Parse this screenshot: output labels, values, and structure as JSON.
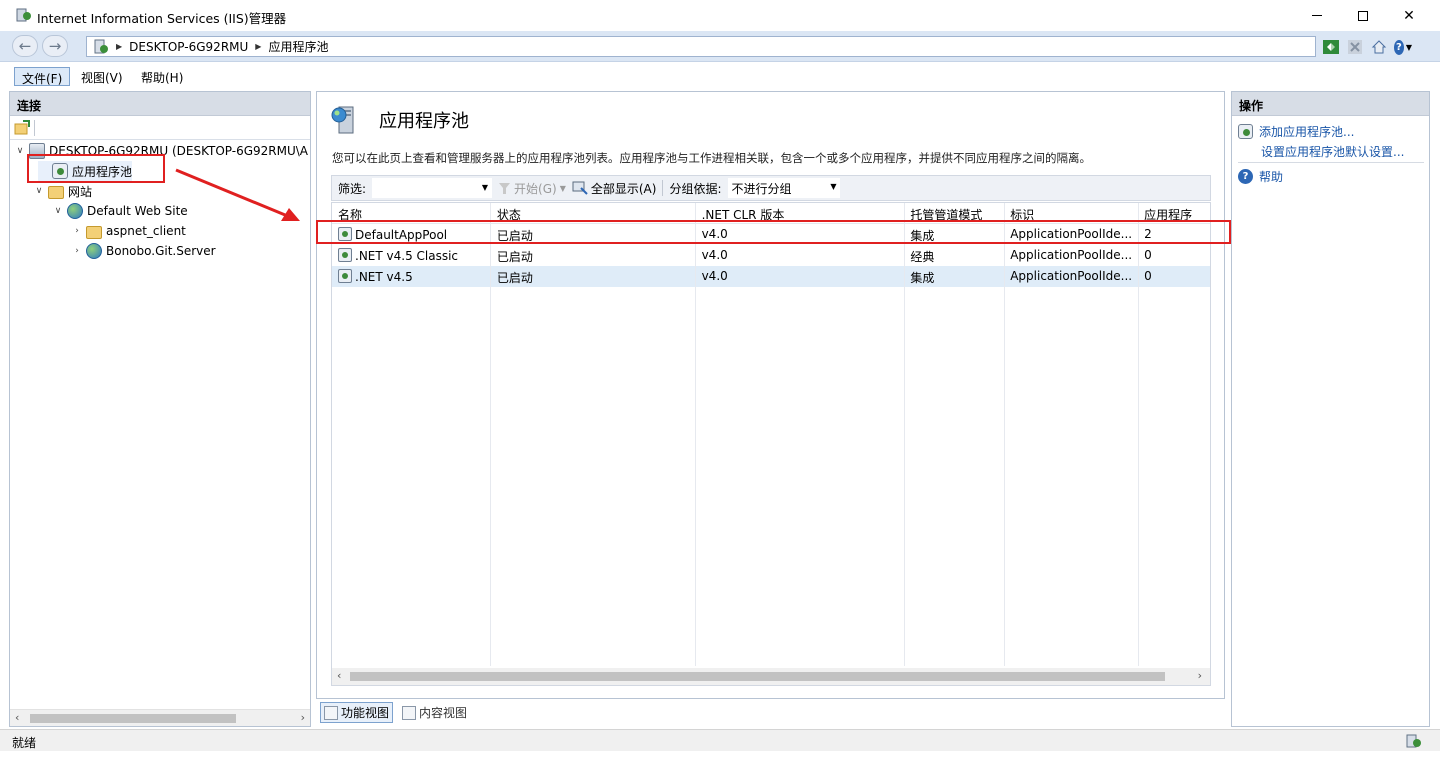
{
  "window": {
    "title": "Internet Information Services (IIS)管理器",
    "minimize": "—",
    "maximize": "□",
    "close": "✕"
  },
  "navbar": {
    "back": "←",
    "forward": "→",
    "breadcrumb": [
      "DESKTOP-6G92RMU",
      "应用程序池"
    ]
  },
  "menu": {
    "file": "文件(F)",
    "view": "视图(V)",
    "help": "帮助(H)"
  },
  "connections": {
    "header": "连接",
    "tree": [
      {
        "label": "DESKTOP-6G92RMU (DESKTOP-6G92RMU\\A",
        "icon": "server-icon",
        "twisty": "∨"
      },
      {
        "label": "应用程序池",
        "icon": "app-pool-icon",
        "twisty": ""
      },
      {
        "label": "网站",
        "icon": "folder-icon",
        "twisty": "∨"
      },
      {
        "label": "Default Web Site",
        "icon": "globe-icon",
        "twisty": "∨"
      },
      {
        "label": "aspnet_client",
        "icon": "folder-icon",
        "twisty": "›"
      },
      {
        "label": "Bonobo.Git.Server",
        "icon": "globe-icon",
        "twisty": "›"
      }
    ]
  },
  "main": {
    "title": "应用程序池",
    "description": "您可以在此页上查看和管理服务器上的应用程序池列表。应用程序池与工作进程相关联，包含一个或多个应用程序，并提供不同应用程序之间的隔离。",
    "filter": {
      "label": "筛选:",
      "start": "开始(G)",
      "show_all": "全部显示(A)",
      "group_by_label": "分组依据:",
      "group_by_value": "不进行分组"
    },
    "columns": [
      "名称",
      "状态",
      ".NET CLR 版本",
      "托管管道模式",
      "标识",
      "应用程序"
    ],
    "rows": [
      [
        "DefaultAppPool",
        "已启动",
        "v4.0",
        "集成",
        "ApplicationPoolIde...",
        "2"
      ],
      [
        ".NET v4.5 Classic",
        "已启动",
        "v4.0",
        "经典",
        "ApplicationPoolIde...",
        "0"
      ],
      [
        ".NET v4.5",
        "已启动",
        "v4.0",
        "集成",
        "ApplicationPoolIde...",
        "0"
      ]
    ],
    "view_tabs": {
      "features": "功能视图",
      "content": "内容视图"
    }
  },
  "actions": {
    "header": "操作",
    "add_pool": "添加应用程序池...",
    "set_defaults": "设置应用程序池默认设置...",
    "help": "帮助"
  },
  "status": {
    "text": "就绪"
  },
  "colors": {
    "highlight": "#e02020",
    "link": "#1a56a8",
    "navbar": "#dbe6f4"
  }
}
